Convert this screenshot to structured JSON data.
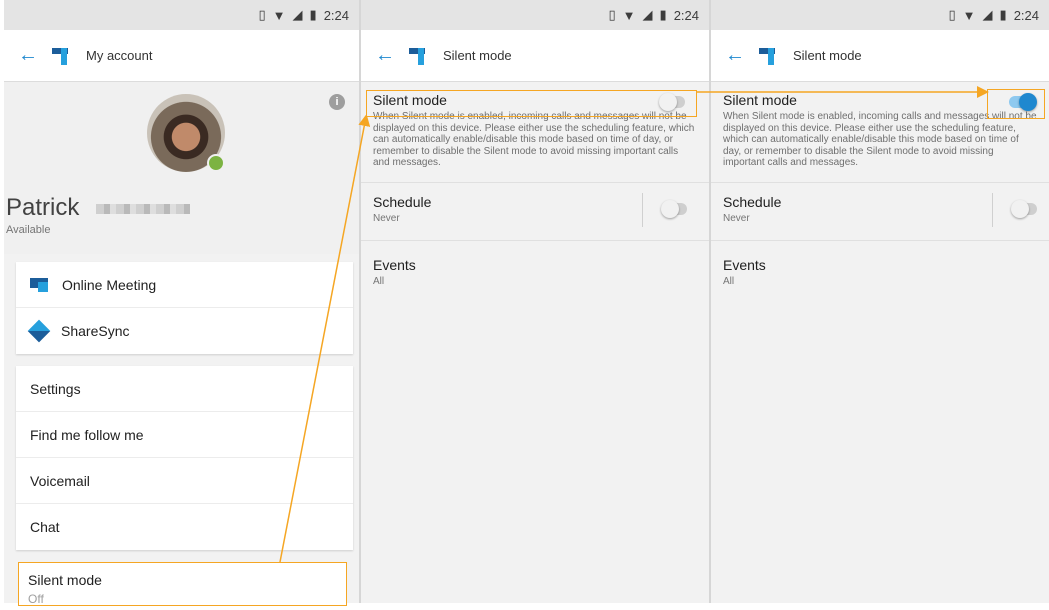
{
  "status_bar": {
    "time": "2:24"
  },
  "screen1": {
    "toolbar_title": "My account",
    "profile": {
      "name": "Patrick",
      "status": "Available"
    },
    "card1": [
      "Online Meeting",
      "ShareSync"
    ],
    "card2": [
      "Settings",
      "Find me follow me",
      "Voicemail",
      "Chat"
    ],
    "silent_mode": {
      "label": "Silent mode",
      "value": "Off"
    }
  },
  "screen2": {
    "toolbar_title": "Silent mode",
    "silent_mode": {
      "title": "Silent mode",
      "description": "When Silent mode is enabled, incoming calls and messages will not be displayed on this device. Please either use the scheduling feature, which can automatically enable/disable this mode based on time of day, or remember to disable the Silent mode to avoid missing important calls and messages.",
      "enabled": false
    },
    "schedule": {
      "title": "Schedule",
      "value": "Never",
      "enabled": false
    },
    "events": {
      "title": "Events",
      "value": "All"
    }
  },
  "screen3": {
    "toolbar_title": "Silent mode",
    "silent_mode": {
      "title": "Silent mode",
      "description": "When Silent mode is enabled, incoming calls and messages will not be displayed on this device. Please either use the scheduling feature, which can automatically enable/disable this mode based on time of day, or remember to disable the Silent mode to avoid missing important calls and messages.",
      "enabled": true
    },
    "schedule": {
      "title": "Schedule",
      "value": "Never",
      "enabled": false
    },
    "events": {
      "title": "Events",
      "value": "All"
    }
  },
  "colors": {
    "accent": "#1f88cf",
    "annotation": "#f5a623",
    "presence": "#7cb342"
  }
}
